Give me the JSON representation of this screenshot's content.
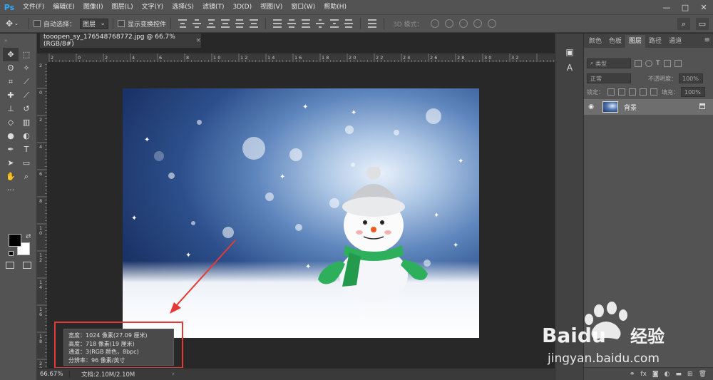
{
  "app": {
    "logo": "Ps"
  },
  "menu": [
    "文件(F)",
    "编辑(E)",
    "图像(I)",
    "图层(L)",
    "文字(Y)",
    "选择(S)",
    "滤镜(T)",
    "3D(D)",
    "视图(V)",
    "窗口(W)",
    "帮助(H)"
  ],
  "window_controls": [
    "—",
    "□",
    "✕"
  ],
  "options": {
    "auto_select_label": "自动选择：",
    "auto_select_value": "图层",
    "show_transform_label": "显示变换控件",
    "mode3d_label": "3D 模式："
  },
  "document": {
    "tab_title": "tooopen_sy_176548768772.jpg @ 66.7%(RGB/8#)",
    "tab_close": "×"
  },
  "ruler_h_labels": [
    "2",
    "0",
    "2",
    "4",
    "6",
    "8",
    "1 0",
    "1 2",
    "1 4",
    "1 6",
    "1 8",
    "2 0",
    "2 2",
    "2 4",
    "2 6",
    "2 8",
    "3 0",
    "3 2"
  ],
  "ruler_v_labels": [
    "2",
    "0",
    "2",
    "4",
    "6",
    "8",
    "1 0",
    "1 2",
    "1 4",
    "1 6",
    "1 8",
    "2 0"
  ],
  "info_popup": {
    "width": "宽度：1024 像素(27.09 厘米)",
    "height": "高度：718 像素(19 厘米)",
    "channels": "通道：3(RGB 颜色，8bpc)",
    "resolution": "分辨率：96 像素/英寸"
  },
  "status": {
    "zoom": "66.67%",
    "doc_size": "文档:2.10M/2.10M",
    "arrow": "›"
  },
  "layers_panel": {
    "tabs": [
      "颜色",
      "色板",
      "图层",
      "路径",
      "通道"
    ],
    "active_tab": "图层",
    "filter_kind": "类型",
    "blend_mode": "正常",
    "opacity_label": "不透明度：",
    "opacity_value": "100%",
    "lock_label": "锁定：",
    "fill_label": "填充：",
    "fill_value": "100%",
    "layers": [
      {
        "name": "背景",
        "visible": true,
        "locked": true
      }
    ]
  },
  "watermark": {
    "brand": "Baidu",
    "product": "经验",
    "url": "jingyan.baidu.com"
  },
  "colors": {
    "annotation": "#e53935",
    "chrome": "#535353",
    "canvas_bg": "#282828"
  }
}
